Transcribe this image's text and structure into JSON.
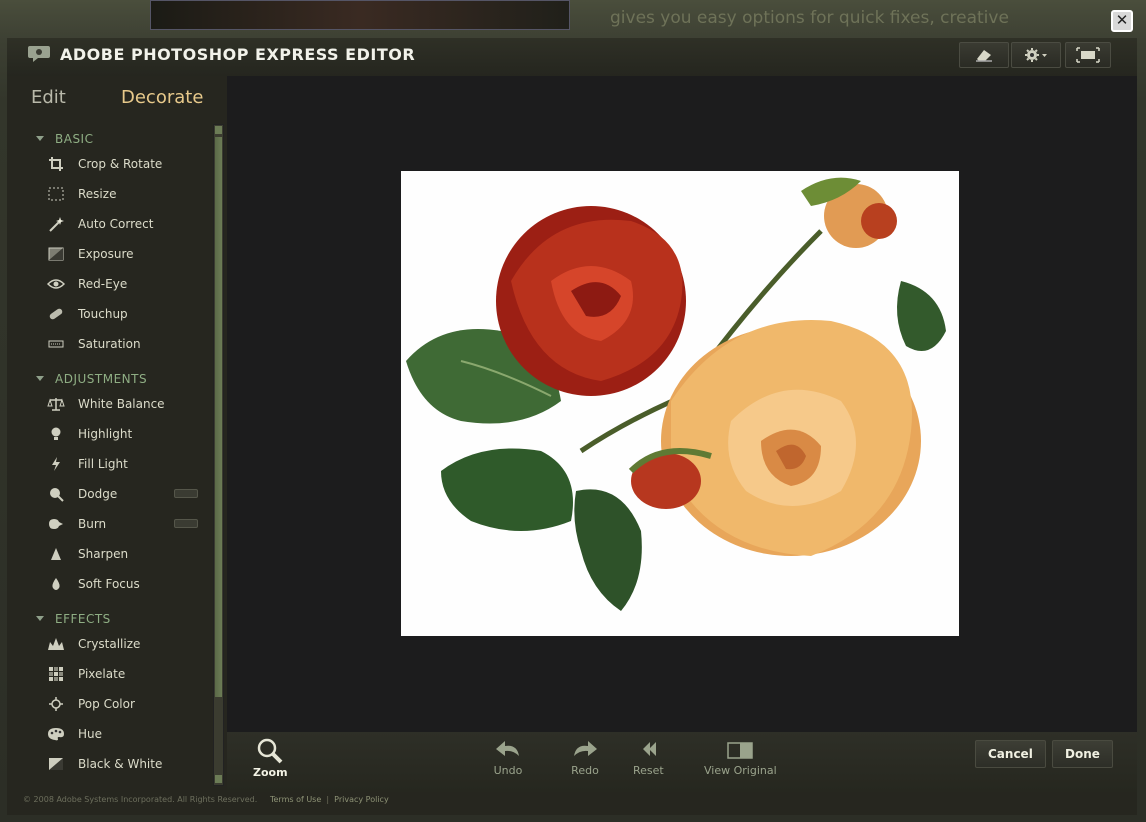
{
  "background": {
    "text": "gives you easy options for quick fixes, creative"
  },
  "window": {
    "title": "ADOBE PHOTOSHOP EXPRESS EDITOR"
  },
  "tabs": [
    {
      "label": "Edit",
      "active": false
    },
    {
      "label": "Decorate",
      "active": true
    }
  ],
  "sections": [
    {
      "title": "BASIC",
      "tools": [
        "Crop & Rotate",
        "Resize",
        "Auto Correct",
        "Exposure",
        "Red-Eye",
        "Touchup",
        "Saturation"
      ]
    },
    {
      "title": "ADJUSTMENTS",
      "tools": [
        "White Balance",
        "Highlight",
        "Fill Light",
        "Dodge",
        "Burn",
        "Sharpen",
        "Soft Focus"
      ]
    },
    {
      "title": "EFFECTS",
      "tools": [
        "Crystallize",
        "Pixelate",
        "Pop Color",
        "Hue",
        "Black & White"
      ]
    }
  ],
  "bottom": {
    "zoom": "Zoom",
    "undo": "Undo",
    "redo": "Redo",
    "reset": "Reset",
    "view_original": "View Original",
    "cancel": "Cancel",
    "done": "Done"
  },
  "footer": {
    "copyright": "© 2008 Adobe Systems Incorporated. All Rights Reserved.",
    "terms": "Terms of Use",
    "separator": "|",
    "privacy": "Privacy Policy"
  },
  "colors": {
    "accent_tab": "#e7c98b",
    "section_header": "#8fae84",
    "canvas_bg": "#1c1c1d"
  }
}
